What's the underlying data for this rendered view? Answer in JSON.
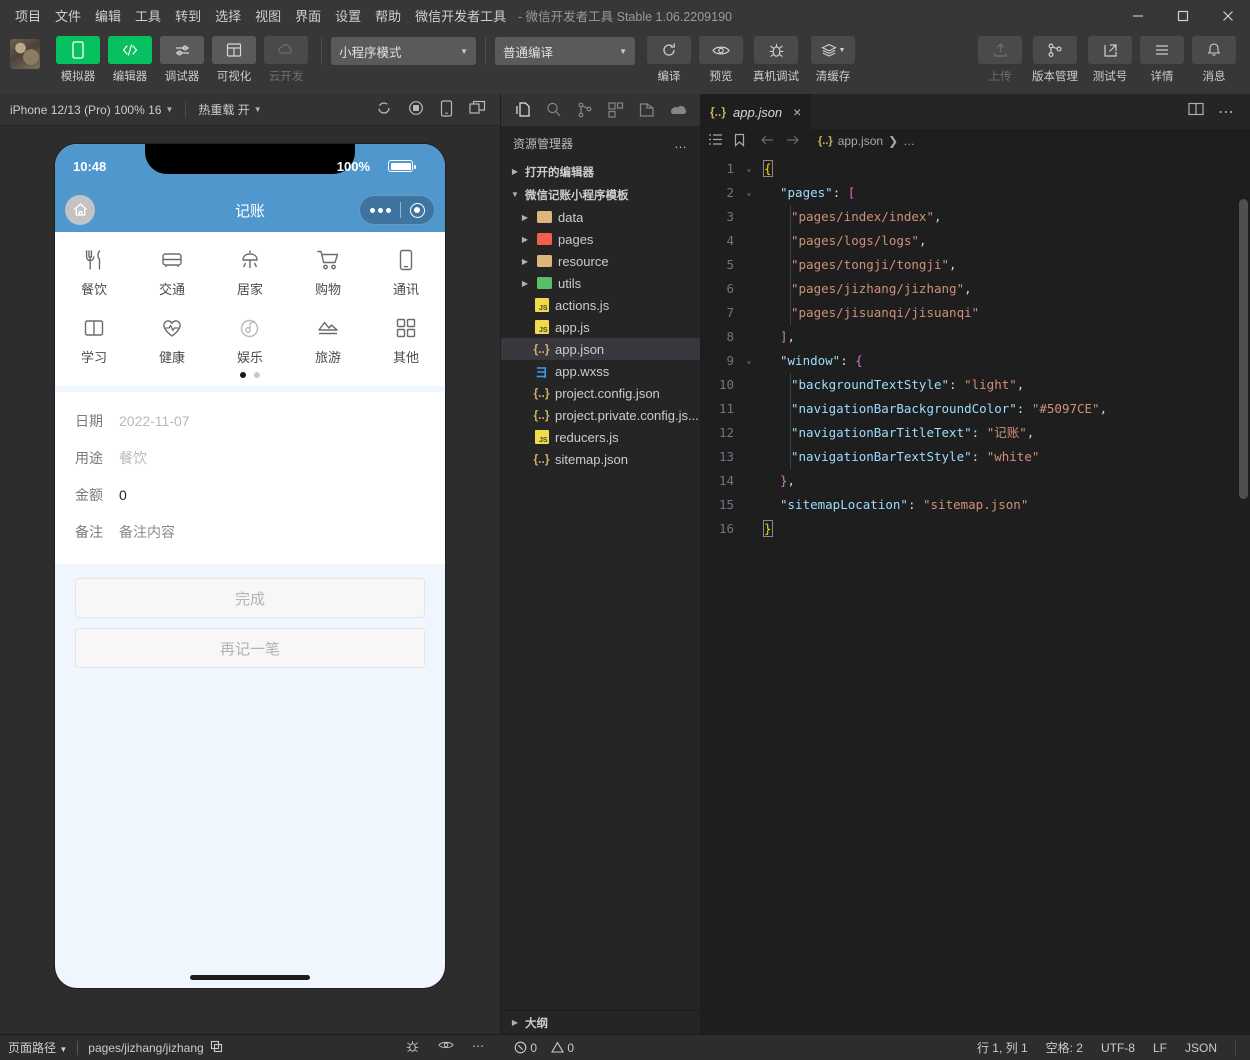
{
  "window": {
    "title": "- 微信开发者工具 Stable 1.06.2209190",
    "menu": [
      "项目",
      "文件",
      "编辑",
      "工具",
      "转到",
      "选择",
      "视图",
      "界面",
      "设置",
      "帮助",
      "微信开发者工具"
    ],
    "controls": {
      "minimize": "minimize-icon",
      "maximize": "maximize-icon",
      "close": "close-icon"
    }
  },
  "toolbar": {
    "left_buttons": [
      {
        "label": "模拟器",
        "icon": "phone-icon",
        "state": "active"
      },
      {
        "label": "编辑器",
        "icon": "code-icon",
        "state": "active"
      },
      {
        "label": "调试器",
        "icon": "sliders-icon",
        "state": "normal"
      },
      {
        "label": "可视化",
        "icon": "layout-icon",
        "state": "normal"
      },
      {
        "label": "云开发",
        "icon": "cloud-icon",
        "state": "disabled"
      }
    ],
    "mode_select": "小程序模式",
    "compile_select": "普通编译",
    "mid_buttons": [
      {
        "label": "编译",
        "icon": "refresh-icon"
      },
      {
        "label": "预览",
        "icon": "eye-icon"
      },
      {
        "label": "真机调试",
        "icon": "bug-icon"
      },
      {
        "label": "清缓存",
        "icon": "layers-icon"
      }
    ],
    "right_buttons": [
      {
        "label": "上传",
        "icon": "upload-icon",
        "state": "disabled"
      },
      {
        "label": "版本管理",
        "icon": "branch-icon",
        "state": "normal"
      },
      {
        "label": "测试号",
        "icon": "external-link-icon",
        "state": "normal"
      },
      {
        "label": "详情",
        "icon": "menu-icon",
        "state": "normal"
      },
      {
        "label": "消息",
        "icon": "bell-icon",
        "state": "normal"
      }
    ]
  },
  "simulator": {
    "device": "iPhone 12/13 (Pro) 100% 16",
    "hot_reload": "热重载 开",
    "toolbar_icons": [
      "refresh-icon",
      "record-icon",
      "rotate-device-icon",
      "multi-window-icon"
    ],
    "phone": {
      "status_time": "10:48",
      "battery_percent": "100%",
      "nav_title": "记账",
      "home_icon": "home-icon",
      "categories": [
        {
          "label": "餐饮",
          "icon": "cutlery-icon"
        },
        {
          "label": "交通",
          "icon": "bus-icon"
        },
        {
          "label": "居家",
          "icon": "lamp-icon"
        },
        {
          "label": "购物",
          "icon": "cart-icon"
        },
        {
          "label": "通讯",
          "icon": "mobile-icon"
        },
        {
          "label": "学习",
          "icon": "book-icon"
        },
        {
          "label": "健康",
          "icon": "heartbeat-icon"
        },
        {
          "label": "娱乐",
          "icon": "music-icon"
        },
        {
          "label": "旅游",
          "icon": "mountain-icon"
        },
        {
          "label": "其他",
          "icon": "grid-icon"
        }
      ],
      "pager": {
        "total": 2,
        "active": 1
      },
      "form": [
        {
          "label": "日期",
          "value": "2022-11-07"
        },
        {
          "label": "用途",
          "value": "餐饮"
        },
        {
          "label": "金额",
          "value": "0"
        },
        {
          "label": "备注",
          "value": "备注内容"
        }
      ],
      "buttons": [
        "完成",
        "再记一笔"
      ]
    }
  },
  "explorer": {
    "activity_icons": [
      "files-icon",
      "search-icon",
      "source-control-icon",
      "extensions-icon",
      "debug-icon",
      "wechat-cloud-icon"
    ],
    "title": "资源管理器",
    "more": "…",
    "sections": [
      {
        "label": "打开的编辑器",
        "expanded": false
      },
      {
        "label": "微信记账小程序模板",
        "expanded": true
      }
    ],
    "files": [
      {
        "name": "data",
        "type": "folder",
        "color": "#dcb67a",
        "expanded": false
      },
      {
        "name": "pages",
        "type": "folder",
        "color": "#f0604d",
        "expanded": false
      },
      {
        "name": "resource",
        "type": "folder",
        "color": "#dcb67a",
        "expanded": false
      },
      {
        "name": "utils",
        "type": "folder",
        "color": "#58c06a",
        "expanded": false
      },
      {
        "name": "actions.js",
        "type": "js"
      },
      {
        "name": "app.js",
        "type": "js"
      },
      {
        "name": "app.json",
        "type": "json",
        "selected": true
      },
      {
        "name": "app.wxss",
        "type": "wxss"
      },
      {
        "name": "project.config.json",
        "type": "json"
      },
      {
        "name": "project.private.config.js...",
        "type": "json"
      },
      {
        "name": "reducers.js",
        "type": "js"
      },
      {
        "name": "sitemap.json",
        "type": "json"
      }
    ],
    "outline": "大纲"
  },
  "editor": {
    "tab": {
      "name": "app.json",
      "icon": "json-icon",
      "close": "×"
    },
    "actions": [
      "split-editor-icon",
      "more-actions-icon"
    ],
    "breadcrumb": {
      "file": "app.json",
      "separator": "❯",
      "rest": "…"
    },
    "lines": [
      {
        "n": 1,
        "fold": "v",
        "indent": 0,
        "tokens": [
          {
            "t": "{",
            "c": "brkbox"
          }
        ]
      },
      {
        "n": 2,
        "fold": "v",
        "indent": 1,
        "tokens": [
          {
            "t": "\"pages\"",
            "c": "key"
          },
          {
            "t": ": ",
            "c": "pun"
          },
          {
            "t": "[",
            "c": "brk2"
          }
        ]
      },
      {
        "n": 3,
        "fold": "",
        "indent": 2,
        "guide": true,
        "tokens": [
          {
            "t": "\"pages/index/index\"",
            "c": "str"
          },
          {
            "t": ",",
            "c": "pun"
          }
        ]
      },
      {
        "n": 4,
        "fold": "",
        "indent": 2,
        "guide": true,
        "tokens": [
          {
            "t": "\"pages/logs/logs\"",
            "c": "str"
          },
          {
            "t": ",",
            "c": "pun"
          }
        ]
      },
      {
        "n": 5,
        "fold": "",
        "indent": 2,
        "guide": true,
        "tokens": [
          {
            "t": "\"pages/tongji/tongji\"",
            "c": "str"
          },
          {
            "t": ",",
            "c": "pun"
          }
        ]
      },
      {
        "n": 6,
        "fold": "",
        "indent": 2,
        "guide": true,
        "tokens": [
          {
            "t": "\"pages/jizhang/jizhang\"",
            "c": "str"
          },
          {
            "t": ",",
            "c": "pun"
          }
        ]
      },
      {
        "n": 7,
        "fold": "",
        "indent": 2,
        "guide": true,
        "tokens": [
          {
            "t": "\"pages/jisuanqi/jisuanqi\"",
            "c": "str"
          }
        ]
      },
      {
        "n": 8,
        "fold": "",
        "indent": 1,
        "tokens": [
          {
            "t": "]",
            "c": "brk2"
          },
          {
            "t": ",",
            "c": "pun"
          }
        ]
      },
      {
        "n": 9,
        "fold": "v",
        "indent": 1,
        "tokens": [
          {
            "t": "\"window\"",
            "c": "key"
          },
          {
            "t": ": ",
            "c": "pun"
          },
          {
            "t": "{",
            "c": "brk2"
          }
        ]
      },
      {
        "n": 10,
        "fold": "",
        "indent": 2,
        "guide": true,
        "tokens": [
          {
            "t": "\"backgroundTextStyle\"",
            "c": "key"
          },
          {
            "t": ": ",
            "c": "pun"
          },
          {
            "t": "\"light\"",
            "c": "str"
          },
          {
            "t": ",",
            "c": "pun"
          }
        ]
      },
      {
        "n": 11,
        "fold": "",
        "indent": 2,
        "guide": true,
        "tokens": [
          {
            "t": "\"navigationBarBackgroundColor\"",
            "c": "key"
          },
          {
            "t": ": ",
            "c": "pun"
          },
          {
            "t": "\"#5097CE\"",
            "c": "str"
          },
          {
            "t": ",",
            "c": "pun"
          }
        ]
      },
      {
        "n": 12,
        "fold": "",
        "indent": 2,
        "guide": true,
        "tokens": [
          {
            "t": "\"navigationBarTitleText\"",
            "c": "key"
          },
          {
            "t": ": ",
            "c": "pun"
          },
          {
            "t": "\"记账\"",
            "c": "str"
          },
          {
            "t": ",",
            "c": "pun"
          }
        ]
      },
      {
        "n": 13,
        "fold": "",
        "indent": 2,
        "guide": true,
        "tokens": [
          {
            "t": "\"navigationBarTextStyle\"",
            "c": "key"
          },
          {
            "t": ": ",
            "c": "pun"
          },
          {
            "t": "\"white\"",
            "c": "str"
          }
        ]
      },
      {
        "n": 14,
        "fold": "",
        "indent": 1,
        "tokens": [
          {
            "t": "}",
            "c": "brk2"
          },
          {
            "t": ",",
            "c": "pun"
          }
        ]
      },
      {
        "n": 15,
        "fold": "",
        "indent": 1,
        "tokens": [
          {
            "t": "\"sitemapLocation\"",
            "c": "key"
          },
          {
            "t": ": ",
            "c": "pun"
          },
          {
            "t": "\"sitemap.json\"",
            "c": "str"
          }
        ]
      },
      {
        "n": 16,
        "fold": "",
        "indent": 0,
        "tokens": [
          {
            "t": "}",
            "c": "brkbox"
          }
        ]
      }
    ]
  },
  "statusbar": {
    "page_path_label": "页面路径",
    "page_path_value": "pages/jizhang/jizhang",
    "copy_icon": "copy-icon",
    "sim_icons": [
      "bug-icon",
      "eye-icon",
      "more-icon"
    ],
    "errors": "0",
    "warnings": "0",
    "cursor": "行 1, 列 1",
    "indent": "空格: 2",
    "encoding": "UTF-8",
    "eol": "LF",
    "language": "JSON"
  },
  "colors": {
    "accent_blue": "#5097CE",
    "accent_green": "#07C160",
    "chrome_dark": "#373737",
    "editor_bg": "#1E1E1E",
    "sidebar_bg": "#252526"
  }
}
